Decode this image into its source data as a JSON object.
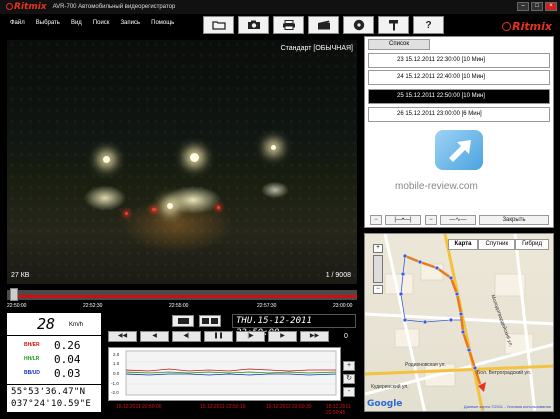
{
  "title_bar": {
    "logo": "Ritmix",
    "app_title": "AVR-700 Автомобильный видеорегистратор",
    "buttons": [
      "–",
      "□",
      "×"
    ]
  },
  "menu": [
    "Файл",
    "Выбрать",
    "Вид",
    "Поиск",
    "Запись",
    "Помощь"
  ],
  "toolbar": {
    "icons": [
      "open-folder-icon",
      "camera-icon",
      "print-icon",
      "clapperboard-icon",
      "disc-icon",
      "hammer-icon",
      "help-icon"
    ],
    "help_label": "?"
  },
  "brand_logo": "Ritmix",
  "video": {
    "mode_label": "Стандарт [ОБЫЧНАЯ]",
    "speed_label": "27 КВ",
    "frame_counter": "1 / 9008"
  },
  "timeline": {
    "labels": [
      "22:50:00",
      "22:52:30",
      "22:55:00",
      "22:57:30",
      "23:00:00"
    ],
    "position": 0.02
  },
  "telemetry": {
    "speed_value": "28",
    "speed_unit": "Km/h",
    "g_sensors": [
      {
        "label": "BH/ER",
        "value": "0.26",
        "color": "#d01010"
      },
      {
        "label": "HH/LR",
        "value": "0.04",
        "color": "#109a10"
      },
      {
        "label": "BB/UD",
        "value": "0.03",
        "color": "#1030c0"
      }
    ],
    "latitude": "55°53'36.47\"N",
    "longitude": "037°24'10.59\"E"
  },
  "controls": {
    "datetime": "THU.15-12-2011 22:50:00",
    "playback_buttons": [
      "◀◀",
      "◀",
      "◀|",
      "❚❚",
      "|▶",
      "▶",
      "▶▶"
    ],
    "counter": "0",
    "graph_times": [
      "15.12.2011 22:50:00",
      "15.12.2011 22:50:15",
      "15.12.2011 22:50:30",
      "15.12.2011 22:50:45"
    ],
    "graph_ticks": [
      "2.0",
      "1.0",
      "0.0",
      "-1.0",
      "-2.0"
    ],
    "side_buttons": [
      "+",
      "↻",
      "-"
    ]
  },
  "file_list": {
    "tab_label": "Список",
    "items": [
      {
        "text": "23  15.12.2011 22:30:00 [10 Мин]",
        "active": false
      },
      {
        "text": "24  15.12.2011 22:40:00 [10 Мин]",
        "active": false
      },
      {
        "text": "25  15.12.2011 22:50:00 [10 Мин]",
        "active": true
      },
      {
        "text": "26  15.12.2011 23:00:00 [6 Мин]",
        "active": false
      }
    ],
    "watermark": "mobile-review.com",
    "close_label": "Закрыть"
  },
  "map": {
    "tabs": [
      "Карта",
      "Спутник",
      "Гибрид"
    ],
    "active_tab": "Карта",
    "streets": [
      "Родионовская ул.",
      "Бол. Ветроградский ул.",
      "Молодогвардейский ул.",
      "Кудеринский ул."
    ],
    "attribution": "Данные карты ©2011 - Условия использования",
    "logo": "Google"
  },
  "colors": {
    "accent": "#e8321e",
    "timeline_red": "#d01010",
    "active_row": "#000000"
  }
}
